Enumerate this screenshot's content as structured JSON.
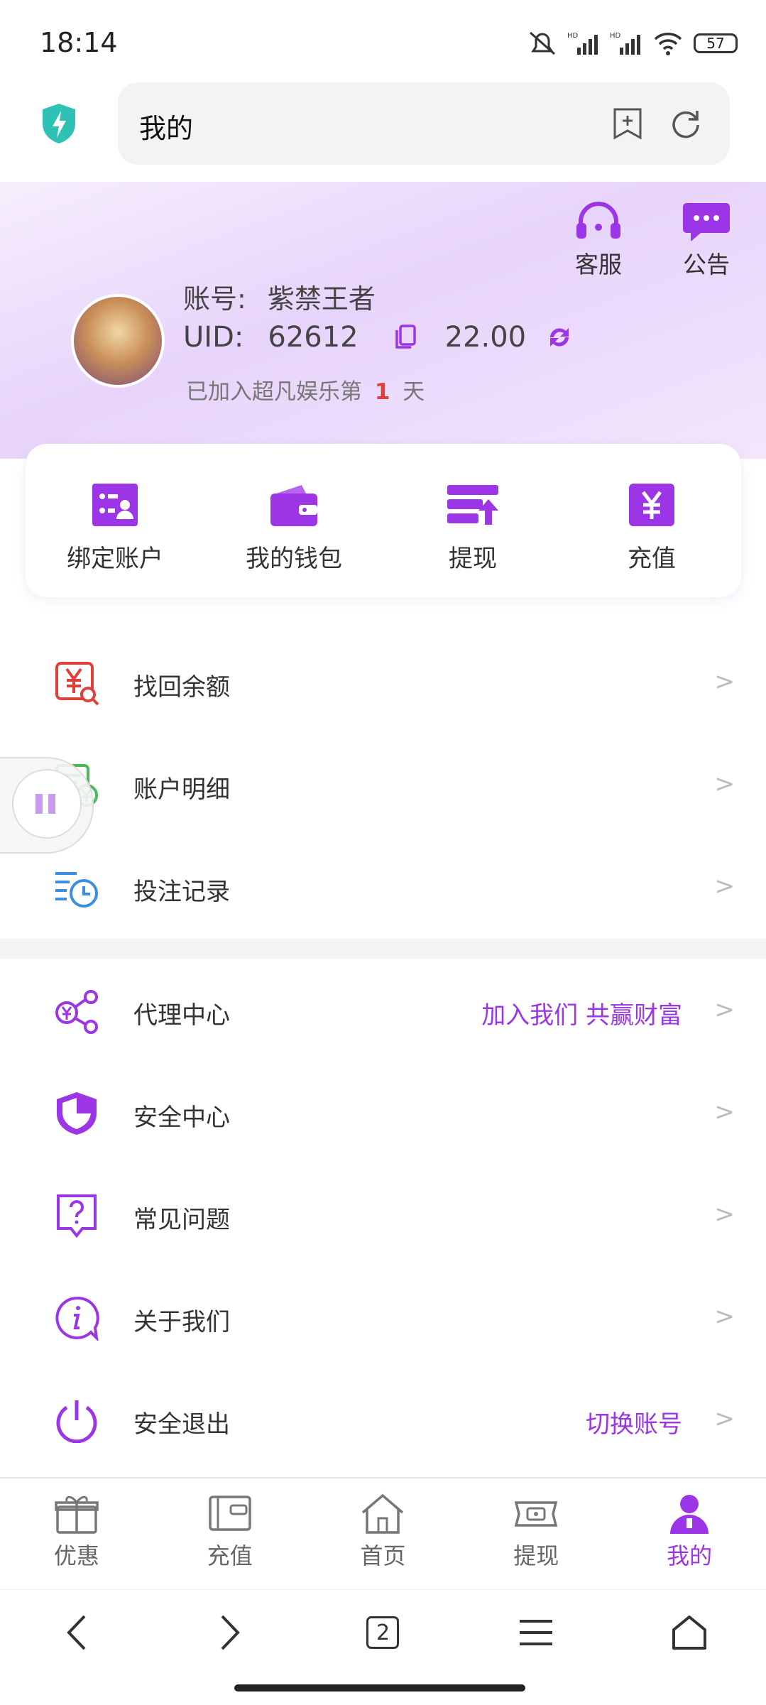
{
  "status_bar": {
    "time": "18:14",
    "battery": "57"
  },
  "address_bar": {
    "title": "我的"
  },
  "header": {
    "service_label": "客服",
    "notice_label": "公告",
    "account_prefix": "账号:",
    "account_name": "紫禁王者",
    "uid_prefix": "UID:",
    "uid": "62612",
    "balance": "22.00",
    "joined_prefix": "已加入超凡娱乐第",
    "joined_days": "1",
    "joined_suffix": "天"
  },
  "quick_actions": [
    {
      "label": "绑定账户",
      "icon": "bind-account-icon"
    },
    {
      "label": "我的钱包",
      "icon": "wallet-icon"
    },
    {
      "label": "提现",
      "icon": "withdraw-icon"
    },
    {
      "label": "充值",
      "icon": "recharge-yen-icon"
    }
  ],
  "menu_group1": [
    {
      "label": "找回余额",
      "icon": "recover-balance-icon"
    },
    {
      "label": "账户明细",
      "icon": "account-detail-icon"
    },
    {
      "label": "投注记录",
      "icon": "bet-history-icon"
    }
  ],
  "menu_group2": [
    {
      "label": "代理中心",
      "extra": "加入我们 共赢财富",
      "icon": "agent-share-icon"
    },
    {
      "label": "安全中心",
      "extra": "",
      "icon": "shield-icon"
    },
    {
      "label": "常见问题",
      "extra": "",
      "icon": "question-icon"
    },
    {
      "label": "关于我们",
      "extra": "",
      "icon": "info-icon"
    },
    {
      "label": "安全退出",
      "extra": "切换账号",
      "icon": "power-icon"
    }
  ],
  "tabs": [
    {
      "label": "优惠",
      "icon": "gift-icon"
    },
    {
      "label": "充值",
      "icon": "recharge-icon"
    },
    {
      "label": "首页",
      "icon": "home-icon"
    },
    {
      "label": "提现",
      "icon": "cash-icon"
    },
    {
      "label": "我的",
      "icon": "user-icon",
      "active": true
    }
  ],
  "browser_nav": {
    "tab_count": "2"
  },
  "colors": {
    "accent": "#9b35e6",
    "red": "#e0403a",
    "green": "#4bb85a",
    "blue": "#3a8fe0"
  }
}
